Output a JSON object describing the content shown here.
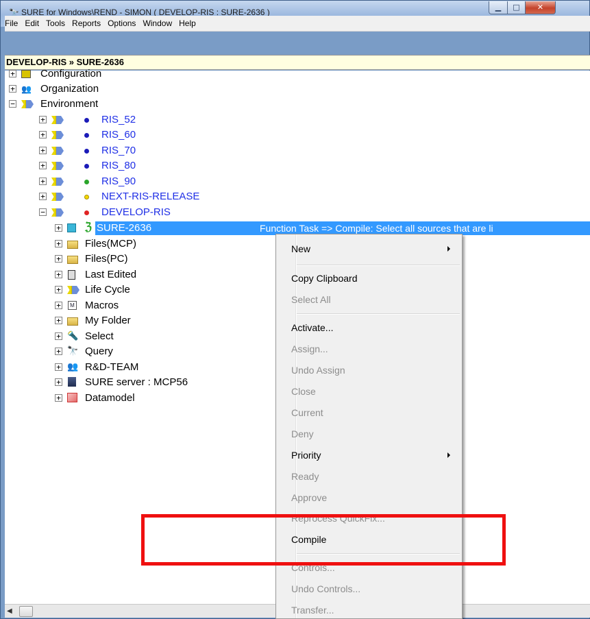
{
  "window": {
    "title": "SURE for Windows\\REND - SIMON ( DEVELOP-RIS : SURE-2636 )",
    "app_icon": "binoculars-icon",
    "controls": {
      "minimize": "minimize-icon",
      "maximize": "maximize-icon",
      "close": "close-icon"
    }
  },
  "menubar": [
    "File",
    "Edit",
    "Tools",
    "Reports",
    "Options",
    "Window",
    "Help"
  ],
  "path": "DEVELOP-RIS » SURE-2636",
  "tree": {
    "root": [
      "Configuration",
      "Organization",
      "Environment"
    ],
    "environments": [
      {
        "label": "RIS_52",
        "status_color": "#1b1bb8"
      },
      {
        "label": "RIS_60",
        "status_color": "#1b1bb8"
      },
      {
        "label": "RIS_70",
        "status_color": "#1b1bb8"
      },
      {
        "label": "RIS_80",
        "status_color": "#1b1bb8"
      },
      {
        "label": "RIS_90",
        "status_color": "#2aa52a"
      },
      {
        "label": "NEXT-RIS-RELEASE",
        "status_color": "#f5d800"
      },
      {
        "label": "DEVELOP-RIS",
        "status_color": "#e02424"
      }
    ],
    "selected": {
      "label": "SURE-2636",
      "description": "Function Task => Compile: Select all sources that are li"
    },
    "children": [
      "Files(MCP)",
      "Files(PC)",
      "Last Edited",
      "Life Cycle",
      "Macros",
      "My Folder",
      "Select",
      "Query",
      "R&D-TEAM",
      "SURE server : MCP56",
      "Datamodel"
    ]
  },
  "context_menu": {
    "items": [
      {
        "label": "New",
        "enabled": true,
        "submenu": true
      },
      {
        "label": "Copy Clipboard",
        "enabled": true
      },
      {
        "label": "Select All",
        "enabled": false
      },
      {
        "label": "Activate...",
        "enabled": true
      },
      {
        "label": "Assign...",
        "enabled": false
      },
      {
        "label": "Undo Assign",
        "enabled": false
      },
      {
        "label": "Close",
        "enabled": false
      },
      {
        "label": "Current",
        "enabled": false
      },
      {
        "label": "Deny",
        "enabled": false
      },
      {
        "label": "Priority",
        "enabled": true,
        "submenu": true
      },
      {
        "label": "Ready",
        "enabled": false
      },
      {
        "label": "Approve",
        "enabled": false
      },
      {
        "label": "Reprocess QuickFix...",
        "enabled": false
      },
      {
        "label": "Compile",
        "enabled": true
      },
      {
        "label": "Controls...",
        "enabled": false
      },
      {
        "label": "Undo Controls...",
        "enabled": false
      },
      {
        "label": "Transfer...",
        "enabled": false
      }
    ]
  },
  "annotation": {
    "highlight_color": "#ef1010"
  }
}
